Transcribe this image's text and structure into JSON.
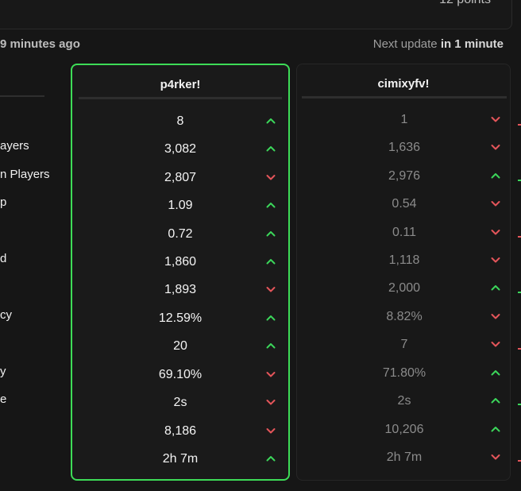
{
  "header": {
    "points": "12 points",
    "updated": "9 minutes ago",
    "next_update_prefix": "Next update",
    "next_update_value": "in 1 minute"
  },
  "labels": [
    "ayers",
    "n Players",
    "p",
    "d",
    "cy",
    "y",
    "e"
  ],
  "columns": [
    {
      "name": "p4rker!",
      "rows": [
        {
          "value": "8",
          "trend": "up"
        },
        {
          "value": "3,082",
          "trend": "up"
        },
        {
          "value": "2,807",
          "trend": "down"
        },
        {
          "value": "1.09",
          "trend": "up"
        },
        {
          "value": "0.72",
          "trend": "up"
        },
        {
          "value": "1,860",
          "trend": "up"
        },
        {
          "value": "1,893",
          "trend": "down"
        },
        {
          "value": "12.59%",
          "trend": "up"
        },
        {
          "value": "20",
          "trend": "up"
        },
        {
          "value": "69.10%",
          "trend": "down"
        },
        {
          "value": "2s",
          "trend": "down"
        },
        {
          "value": "8,186",
          "trend": "down"
        },
        {
          "value": "2h 7m",
          "trend": "up"
        }
      ]
    },
    {
      "name": "cimixyfv!",
      "rows": [
        {
          "value": "1",
          "trend": "down"
        },
        {
          "value": "1,636",
          "trend": "down"
        },
        {
          "value": "2,976",
          "trend": "up"
        },
        {
          "value": "0.54",
          "trend": "down"
        },
        {
          "value": "0.11",
          "trend": "down"
        },
        {
          "value": "1,118",
          "trend": "down"
        },
        {
          "value": "2,000",
          "trend": "up"
        },
        {
          "value": "8.82%",
          "trend": "down"
        },
        {
          "value": "7",
          "trend": "down"
        },
        {
          "value": "71.80%",
          "trend": "up"
        },
        {
          "value": "2s",
          "trend": "up"
        },
        {
          "value": "10,206",
          "trend": "up"
        },
        {
          "value": "2h 7m",
          "trend": "down"
        }
      ]
    }
  ],
  "colors": {
    "up": "#3bd65a",
    "down": "#e4555a",
    "highlight_border": "#3ddc57"
  },
  "icons": {
    "up": "chevron-up-icon",
    "down": "chevron-down-icon"
  }
}
